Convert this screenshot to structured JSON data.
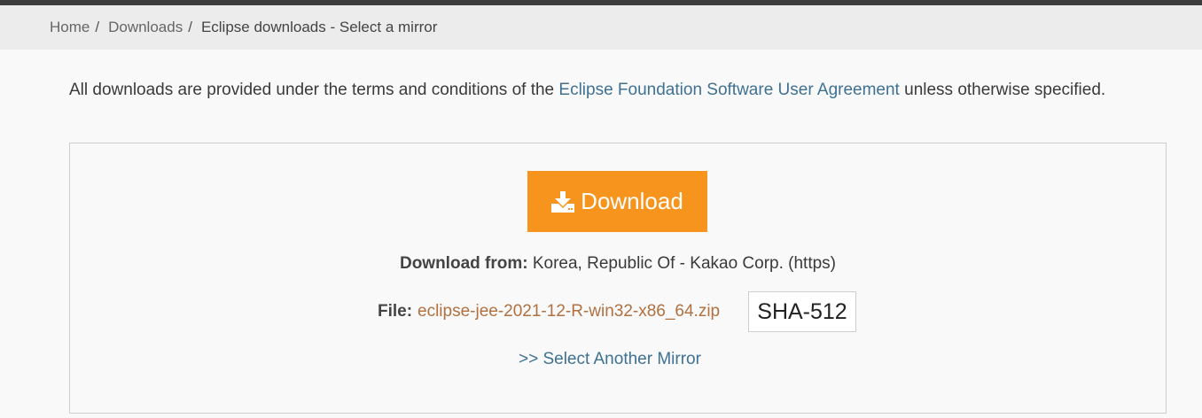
{
  "breadcrumb": {
    "items": [
      {
        "label": "Home"
      },
      {
        "label": "Downloads"
      }
    ],
    "separator": "/",
    "current": "Eclipse downloads - Select a mirror"
  },
  "notice": {
    "prefix": "All downloads are provided under the terms and conditions of the ",
    "link": "Eclipse Foundation Software User Agreement",
    "suffix": " unless otherwise specified."
  },
  "download": {
    "button_label": "Download",
    "icon": "download-icon",
    "from_label": "Download from:",
    "from_value": "Korea, Republic Of - Kakao Corp. (https)",
    "file_label": "File:",
    "file_name": "eclipse-jee-2021-12-R-win32-x86_64.zip",
    "sha_label": "SHA-512",
    "mirror_link": ">> Select Another Mirror"
  },
  "colors": {
    "accent": "#f7941e",
    "link": "#3e7193",
    "file_link": "#b07040"
  }
}
